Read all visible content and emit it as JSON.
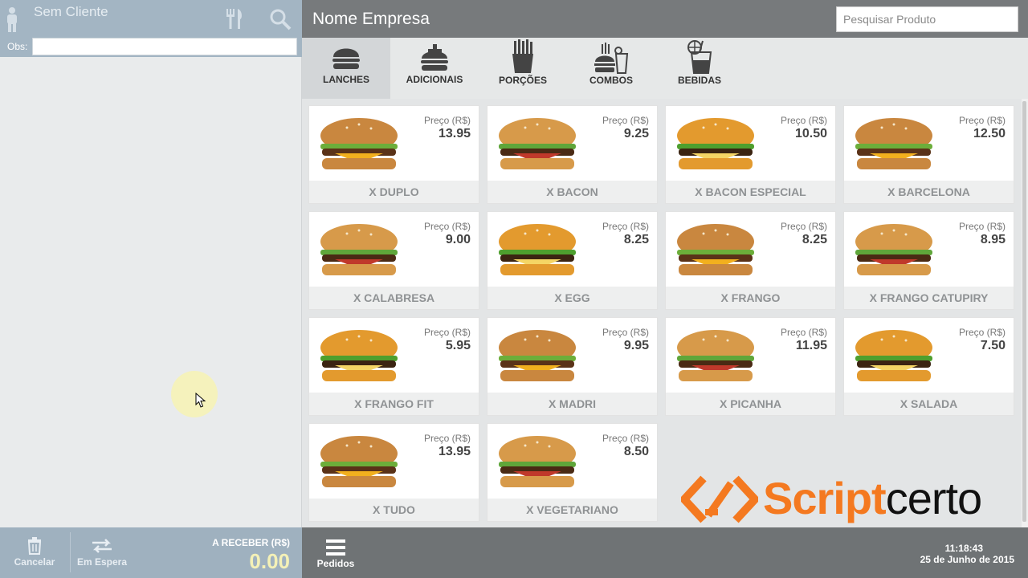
{
  "client": {
    "name": "Sem Cliente",
    "obs_label": "Obs:",
    "obs_value": ""
  },
  "left_bottom": {
    "cancel_label": "Cancelar",
    "hold_label": "Em Espera",
    "receive_label": "A RECEBER (R$)",
    "receive_value": "0.00"
  },
  "header": {
    "company": "Nome Empresa",
    "search_placeholder": "Pesquisar Produto"
  },
  "tabs": [
    {
      "label": "LANCHES",
      "icon": "burger-icon",
      "active": true
    },
    {
      "label": "ADICIONAIS",
      "icon": "burger-plus-icon",
      "active": false
    },
    {
      "label": "PORÇÕES",
      "icon": "fries-icon",
      "active": false
    },
    {
      "label": "COMBOS",
      "icon": "combo-icon",
      "active": false
    },
    {
      "label": "BEBIDAS",
      "icon": "drink-icon",
      "active": false
    }
  ],
  "products": [
    {
      "name": "X DUPLO",
      "price_label": "Preço (R$)",
      "price": "13.95"
    },
    {
      "name": "X BACON",
      "price_label": "Preço (R$)",
      "price": "9.25"
    },
    {
      "name": "X BACON ESPECIAL",
      "price_label": "Preço (R$)",
      "price": "10.50"
    },
    {
      "name": "X BARCELONA",
      "price_label": "Preço (R$)",
      "price": "12.50"
    },
    {
      "name": "X CALABRESA",
      "price_label": "Preço (R$)",
      "price": "9.00"
    },
    {
      "name": "X EGG",
      "price_label": "Preço (R$)",
      "price": "8.25"
    },
    {
      "name": "X FRANGO",
      "price_label": "Preço (R$)",
      "price": "8.25"
    },
    {
      "name": "X FRANGO CATUPIRY",
      "price_label": "Preço (R$)",
      "price": "8.95"
    },
    {
      "name": "X FRANGO FIT",
      "price_label": "Preço (R$)",
      "price": "5.95"
    },
    {
      "name": "X MADRI",
      "price_label": "Preço (R$)",
      "price": "9.95"
    },
    {
      "name": "X PICANHA",
      "price_label": "Preço (R$)",
      "price": "11.95"
    },
    {
      "name": "X SALADA",
      "price_label": "Preço (R$)",
      "price": "7.50"
    },
    {
      "name": "X TUDO",
      "price_label": "Preço (R$)",
      "price": "13.95"
    },
    {
      "name": "X VEGETARIANO",
      "price_label": "Preço (R$)",
      "price": "8.50"
    }
  ],
  "logo": {
    "part1": "Scriptcerto"
  },
  "bottom": {
    "orders_label": "Pedidos",
    "time": "11:18:43",
    "date": "25 de Junho de 2015"
  },
  "colors": {
    "accent": "#f47920",
    "header": "#777a7c",
    "client_bar": "#a3b5c3",
    "total": "#f4f1b7"
  }
}
